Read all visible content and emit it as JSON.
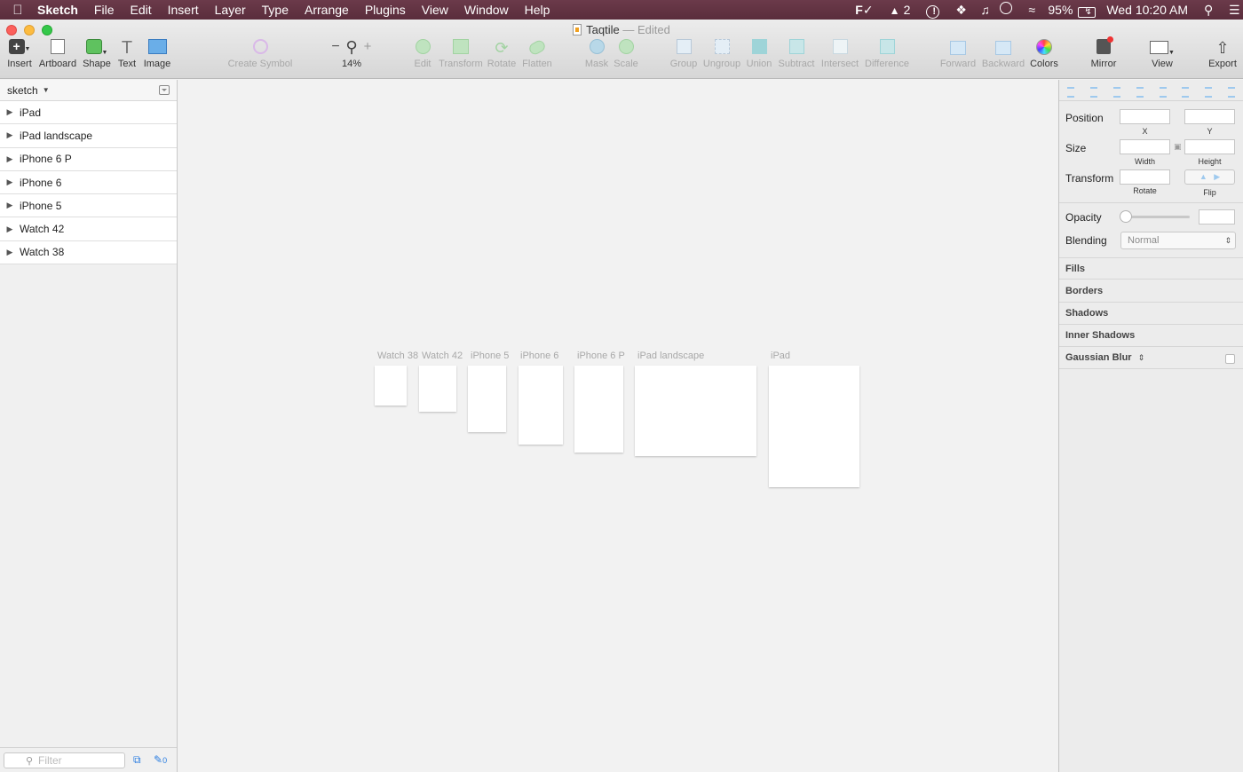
{
  "menubar": {
    "apple": "",
    "app_name": "Sketch",
    "items": [
      "File",
      "Edit",
      "Insert",
      "Layer",
      "Type",
      "Arrange",
      "Plugins",
      "View",
      "Window",
      "Help"
    ],
    "status": {
      "fontcase": "F✓",
      "adobe": "2",
      "battery": "95%",
      "datetime": "Wed 10:20 AM"
    }
  },
  "window": {
    "title": "Taqtile",
    "separator": "—",
    "edited": "Edited"
  },
  "toolbar": {
    "insert": "Insert",
    "artboard": "Artboard",
    "shape": "Shape",
    "text": "Text",
    "image": "Image",
    "create_symbol": "Create Symbol",
    "zoom_minus": "−",
    "zoom_plus": "+",
    "zoom": "14%",
    "edit": "Edit",
    "transform": "Transform",
    "rotate": "Rotate",
    "flatten": "Flatten",
    "mask": "Mask",
    "scale": "Scale",
    "group": "Group",
    "ungroup": "Ungroup",
    "union": "Union",
    "subtract": "Subtract",
    "intersect": "Intersect",
    "difference": "Difference",
    "forward": "Forward",
    "backward": "Backward",
    "colors": "Colors",
    "mirror": "Mirror",
    "view": "View",
    "export": "Export"
  },
  "sidebar": {
    "page_name": "sketch",
    "artboards": [
      "iPad",
      "iPad landscape",
      "iPhone 6 P",
      "iPhone 6",
      "iPhone 5",
      "Watch 42",
      "Watch 38"
    ],
    "filter_placeholder": "Filter",
    "edit_count": "0"
  },
  "canvas": {
    "artboards": [
      "Watch 38",
      "Watch 42",
      "iPhone 5",
      "iPhone 6",
      "iPhone 6 P",
      "iPad landscape",
      "iPad"
    ]
  },
  "inspector": {
    "position": "Position",
    "x": "X",
    "y": "Y",
    "size": "Size",
    "width": "Width",
    "height": "Height",
    "transform": "Transform",
    "rotate": "Rotate",
    "flip": "Flip",
    "opacity": "Opacity",
    "blending": "Blending",
    "blending_value": "Normal",
    "sections": [
      "Fills",
      "Borders",
      "Shadows",
      "Inner Shadows",
      "Gaussian Blur"
    ]
  }
}
